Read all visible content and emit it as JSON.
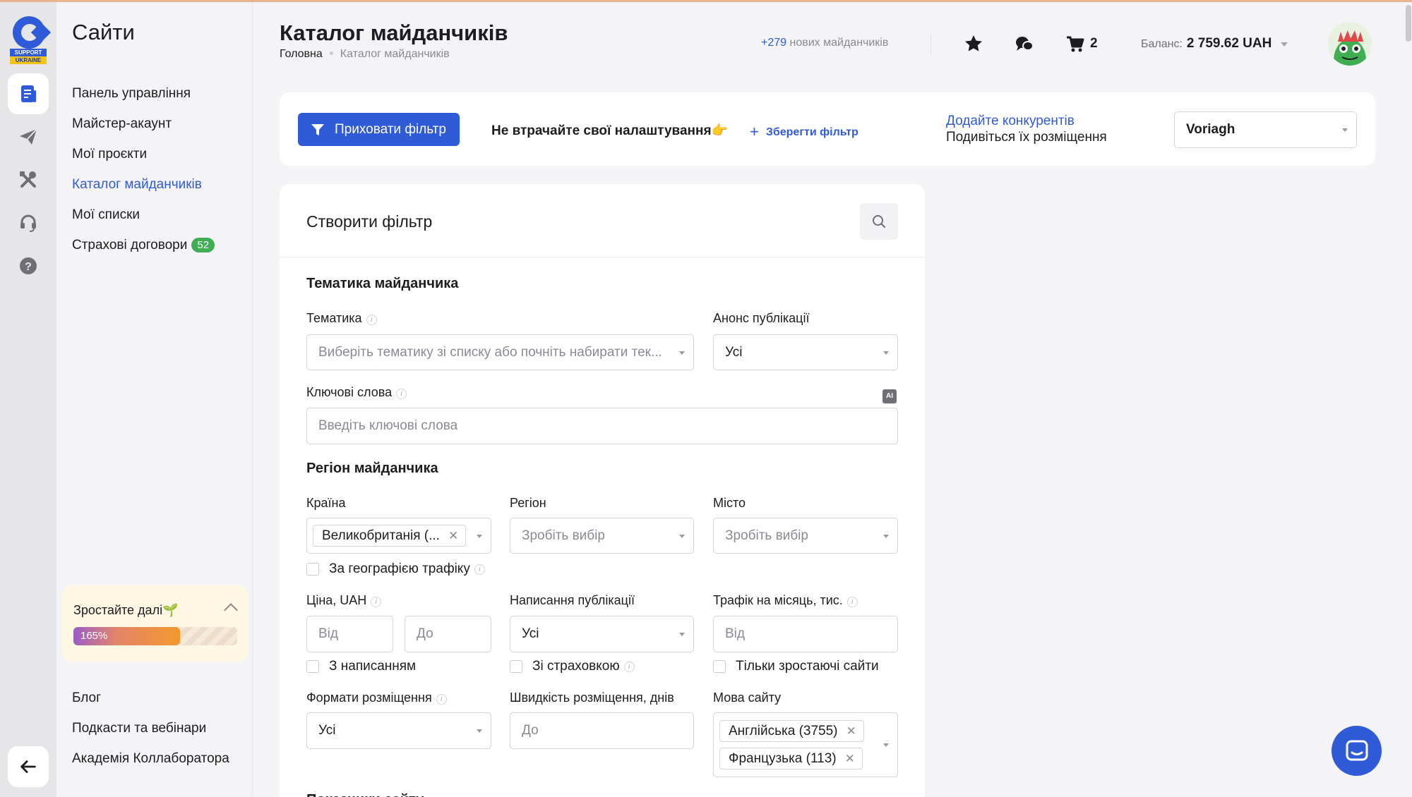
{
  "logo": {
    "line1": "SUPPORT",
    "line2": "UKRAINE"
  },
  "rail": {
    "icons": [
      "sites-icon",
      "send-icon",
      "tools-icon",
      "support-headset-icon",
      "help-icon"
    ],
    "back_icon": "arrow-left-icon"
  },
  "sidebar": {
    "title": "Сайти",
    "items": [
      {
        "label": "Панель управління"
      },
      {
        "label": "Майстер-акаунт"
      },
      {
        "label": "Мої проєкти"
      },
      {
        "label": "Каталог майданчиків",
        "active": true
      },
      {
        "label": "Мої списки"
      },
      {
        "label": "Страхові договори",
        "badge": "52"
      }
    ],
    "grow": {
      "title": "Зростайте далі🌱",
      "progress_label": "165%",
      "progress_fraction": 0.65
    },
    "footer_items": [
      {
        "label": "Блог"
      },
      {
        "label": "Подкасти та вебінари"
      },
      {
        "label": "Академія Коллаборатора"
      }
    ]
  },
  "header": {
    "title": "Каталог майданчиків",
    "breadcrumb": [
      "Головна",
      "Каталог майданчиків"
    ],
    "new_sites_count": "+279",
    "new_sites_text": "нових майданчиків",
    "cart_count": "2",
    "balance_label": "Баланс:",
    "balance_value": "2 759.62 UAH"
  },
  "filter_bar": {
    "hide_button": "Приховати фільтр",
    "keep_settings": "Не втрачайте свої налаштування👉",
    "save_filter": "Зберегти фільтр",
    "competitors_link": "Додайте конкурентів",
    "competitors_sub": "Подивіться їх розміщення",
    "project_select": "Voriagh"
  },
  "form": {
    "title": "Створити фільтр",
    "section_topic": "Тематика майданчика",
    "topic_label": "Тематика",
    "topic_placeholder": "Виберіть тематику зі списку або почніть набирати тек...",
    "announce_label": "Анонс публікації",
    "announce_value": "Усі",
    "keywords_label": "Ключові слова",
    "keywords_placeholder": "Введіть ключові слова",
    "section_region": "Регіон майданчика",
    "country_label": "Країна",
    "country_tag": "Великобританія (...",
    "region_label": "Регіон",
    "region_placeholder": "Зробіть вибір",
    "city_label": "Місто",
    "city_placeholder": "Зробіть вибір",
    "geo_traffic": "За географією трафіку",
    "price_label": "Ціна, UAH",
    "price_from": "Від",
    "price_to": "До",
    "writing_label": "Написання публікації",
    "writing_value": "Усі",
    "traffic_label": "Трафік на місяць, тис.",
    "traffic_from": "Від",
    "with_writing": "З написанням",
    "with_insurance": "Зі страховкою",
    "growing_only": "Тільки зростаючі сайти",
    "formats_label": "Формати розміщення",
    "formats_value": "Усі",
    "speed_label": "Швидкість розміщення, днів",
    "speed_placeholder": "До",
    "language_label": "Мова сайту",
    "language_tags": [
      "Англійська (3755)",
      "Французька (113)"
    ],
    "cut_off_heading": "Показники сайту"
  },
  "colors": {
    "accent": "#2f5bd8",
    "badge_green": "#3fae53",
    "grow_bg": "#fdf7e4"
  }
}
